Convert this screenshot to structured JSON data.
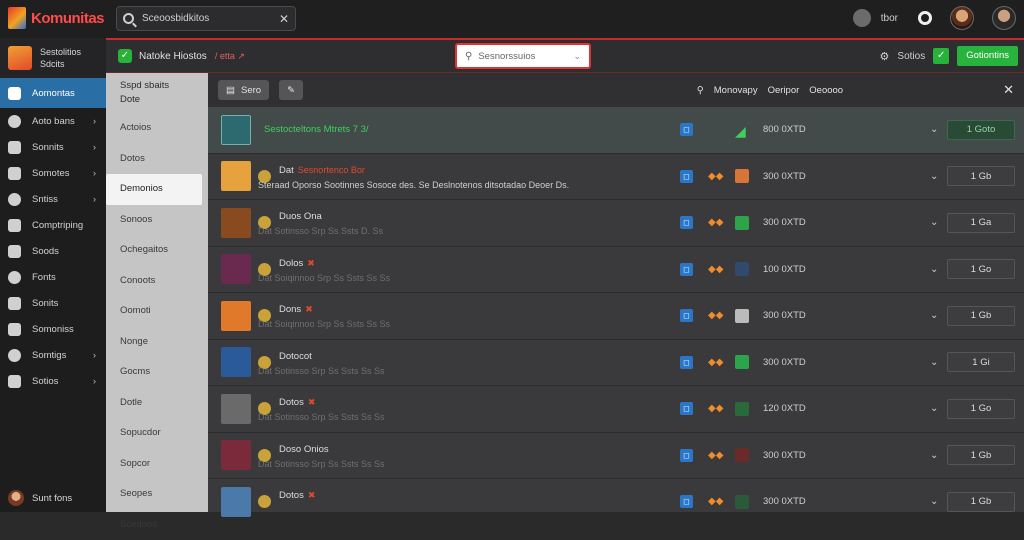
{
  "app": {
    "name": "Komunitas"
  },
  "search": {
    "value": "Sceoosbidkitos",
    "clear_icon": "close-icon"
  },
  "topbar": {
    "user_label": "tbor"
  },
  "sidebar": {
    "brand_line1": "Sestolitios",
    "brand_line2": "Sdcits",
    "items": [
      {
        "label": "Aomontas",
        "icon": "home-icon",
        "active": true
      },
      {
        "label": "Aoto bans",
        "icon": "users-icon",
        "chevron": true
      },
      {
        "label": "Sonnits",
        "icon": "chart-icon",
        "chevron": true
      },
      {
        "label": "Somotes",
        "icon": "globe-icon",
        "chevron": true
      },
      {
        "label": "Sntiss",
        "icon": "grid-icon",
        "chevron": true
      },
      {
        "label": "Comptriping",
        "icon": "chat-icon"
      },
      {
        "label": "Soods",
        "icon": "puzzle-icon"
      },
      {
        "label": "Fonts",
        "icon": "lock-icon"
      },
      {
        "label": "Sonits",
        "icon": "gift-icon"
      },
      {
        "label": "Somoniss",
        "icon": "settings-icon"
      },
      {
        "label": "Somtigs",
        "icon": "link-icon",
        "chevron": true
      },
      {
        "label": "Sotios",
        "icon": "doc-icon",
        "chevron": true
      }
    ],
    "user": "Sunt fons"
  },
  "subbar": {
    "title": "Natoke Hiostos",
    "crumb": "/ etta ↗",
    "dropdown_value": "Sesnorssuios",
    "settings_label": "Sotios",
    "primary_button": "Gotiontins"
  },
  "categories": {
    "head_line1": "Sspd sbaits",
    "head_line2": "Dote",
    "items": [
      {
        "label": "Actoios"
      },
      {
        "label": "Dotos"
      },
      {
        "label": "Demonios",
        "active": true
      },
      {
        "label": "Sonoos"
      },
      {
        "label": "Ochegaitos"
      },
      {
        "label": "Conoots"
      },
      {
        "label": "Oomoti"
      },
      {
        "label": "Nonge"
      },
      {
        "label": "Gocms"
      },
      {
        "label": "Dotle"
      },
      {
        "label": "Sopucdor"
      },
      {
        "label": "Sopcor"
      },
      {
        "label": "Seopes"
      },
      {
        "label": "Scedoos"
      }
    ]
  },
  "toolbar": {
    "btn1": "Sero",
    "btn2": "✎",
    "col_pin": "⚲",
    "col1": "Monovapy",
    "col2": "Oeripor",
    "col3": "Oeoooo"
  },
  "rows": [
    {
      "name": "Sestocteltons Mtrets 7 3/",
      "desc": "",
      "meta": "800 0XTD",
      "btn": "1 Goto",
      "thumb": "#2d6a70",
      "game": "#2ca54a",
      "first": true
    },
    {
      "name": "Dat",
      "tag": "Sesnortenco  Bor",
      "desc": "Steraad Oporso Sootinnes Sosoce des. Se Deslnotenos ditsotadao Deoer Ds.",
      "meta": "300 0XTD",
      "btn": "1 Gb",
      "thumb": "#e6a23c",
      "game": "#d8743a"
    },
    {
      "name": "Duos Ona",
      "desc": "Dat   Sotinsso   Srp  Ss  Ssts  D.  Ss",
      "meta": "300 0XTD",
      "btn": "1 Ga",
      "thumb": "#8a4a20",
      "game": "#2ca54a"
    },
    {
      "name": "Dolos",
      "tag": "✖",
      "desc": "Dat   Soiqinnoo   Srp  Ss  Ssts  Ss  Ss",
      "meta": "100 0XTD",
      "btn": "1 Go",
      "thumb": "#6a2a50",
      "game": "#2f4a6a"
    },
    {
      "name": "Dons",
      "tag": "✖",
      "desc": "Dat   Soiqinnoo   Srp  Ss  Ssts  Ss  Ss",
      "meta": "300 0XTD",
      "btn": "1 Gb",
      "thumb": "#e07a2a",
      "game": "#bbbbbb"
    },
    {
      "name": "Dotocot",
      "desc": "Dat   Sotinsso   Srp  Ss  Ssts  Ss  Ss",
      "meta": "300 0XTD",
      "btn": "1 Gi",
      "thumb": "#2a5a9a",
      "game": "#2ca54a"
    },
    {
      "name": "Dotos",
      "tag": "✖",
      "desc": "Dat   Sotinsso   Srp  Ss  Ssts  Ss  Ss",
      "meta": "120 0XTD",
      "btn": "1 Go",
      "thumb": "#6a6a6a",
      "game": "#2a6a3a"
    },
    {
      "name": "Doso Onios",
      "desc": "Dat   Sotinsso   Srp  Ss  Ssts  Ss  Ss",
      "meta": "300 0XTD",
      "btn": "1 Gb",
      "thumb": "#7a2a3a",
      "game": "#6a2a2a"
    },
    {
      "name": "Dotos",
      "tag": "✖",
      "desc": "",
      "meta": "300 0XTD",
      "btn": "1 Gb",
      "thumb": "#4a7aaa",
      "game": "#2a5a3a"
    }
  ]
}
